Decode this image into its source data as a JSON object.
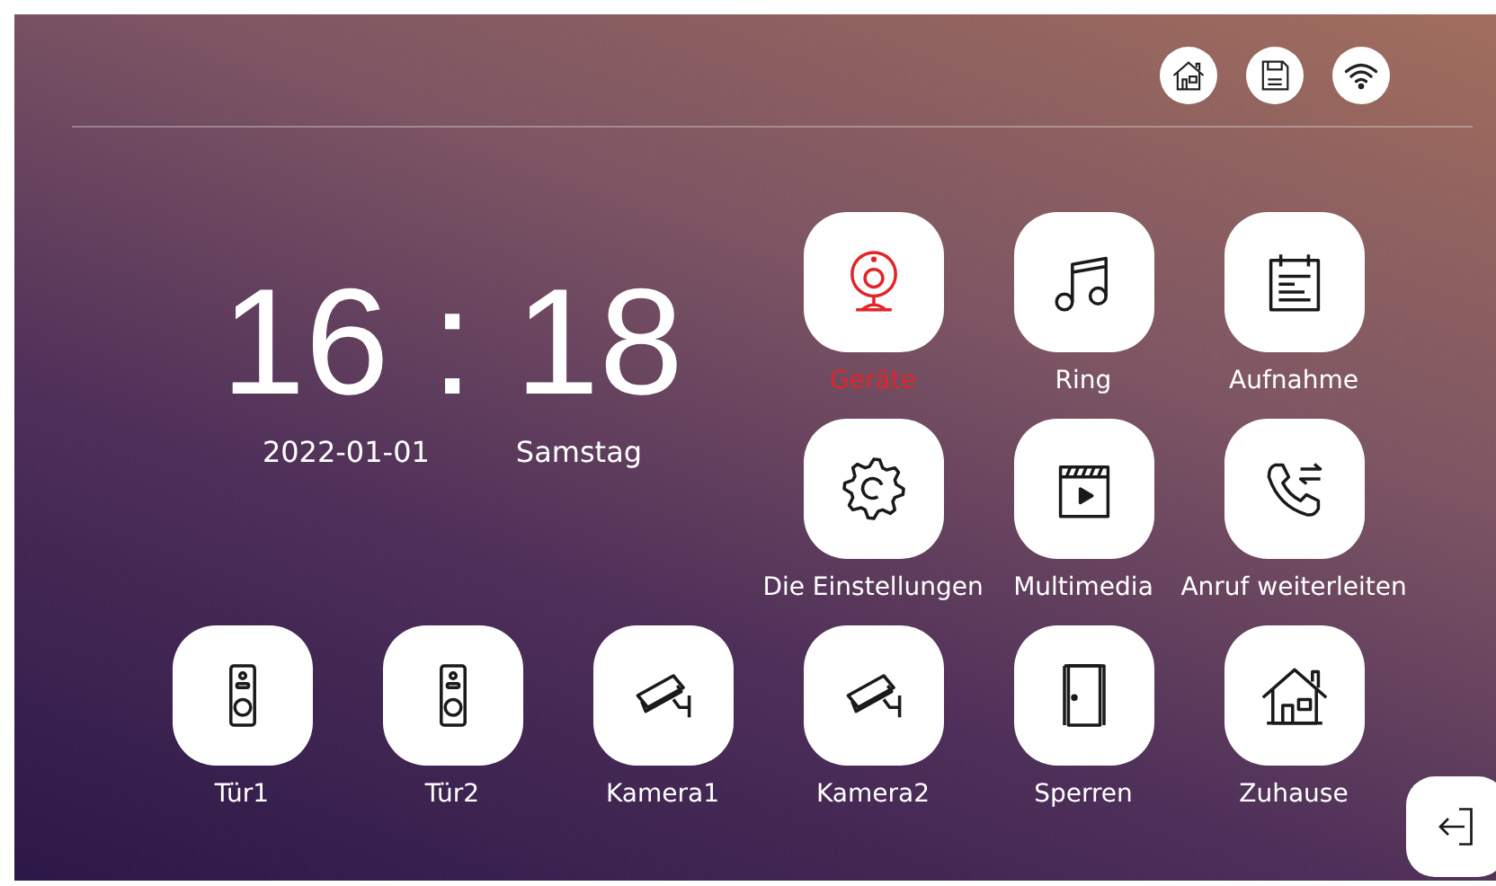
{
  "status_icons": [
    {
      "kind": "home"
    },
    {
      "kind": "storage"
    },
    {
      "kind": "wifi"
    }
  ],
  "clock": {
    "time": "16 : 18",
    "date": "2022-01-01",
    "weekday": "Samstag"
  },
  "apps": [
    {
      "label": "Geräte",
      "kind": "webcam",
      "selected": true
    },
    {
      "label": "Ring",
      "kind": "music",
      "selected": false
    },
    {
      "label": "Aufnahme",
      "kind": "notes",
      "selected": false
    },
    {
      "label": "Die Einstellungen",
      "kind": "gear",
      "selected": false
    },
    {
      "label": "Multimedia",
      "kind": "clapper",
      "selected": false
    },
    {
      "label": "Anruf weiterleiten",
      "kind": "phone-forward",
      "selected": false
    },
    {
      "label": "Tür1",
      "kind": "doorbell",
      "selected": false
    },
    {
      "label": "Tür2",
      "kind": "doorbell",
      "selected": false
    },
    {
      "label": "Kamera1",
      "kind": "cctv",
      "selected": false
    },
    {
      "label": "Kamera2",
      "kind": "cctv",
      "selected": false
    },
    {
      "label": "Sperren",
      "kind": "door",
      "selected": false
    },
    {
      "label": "Zuhause",
      "kind": "house",
      "selected": false
    }
  ]
}
